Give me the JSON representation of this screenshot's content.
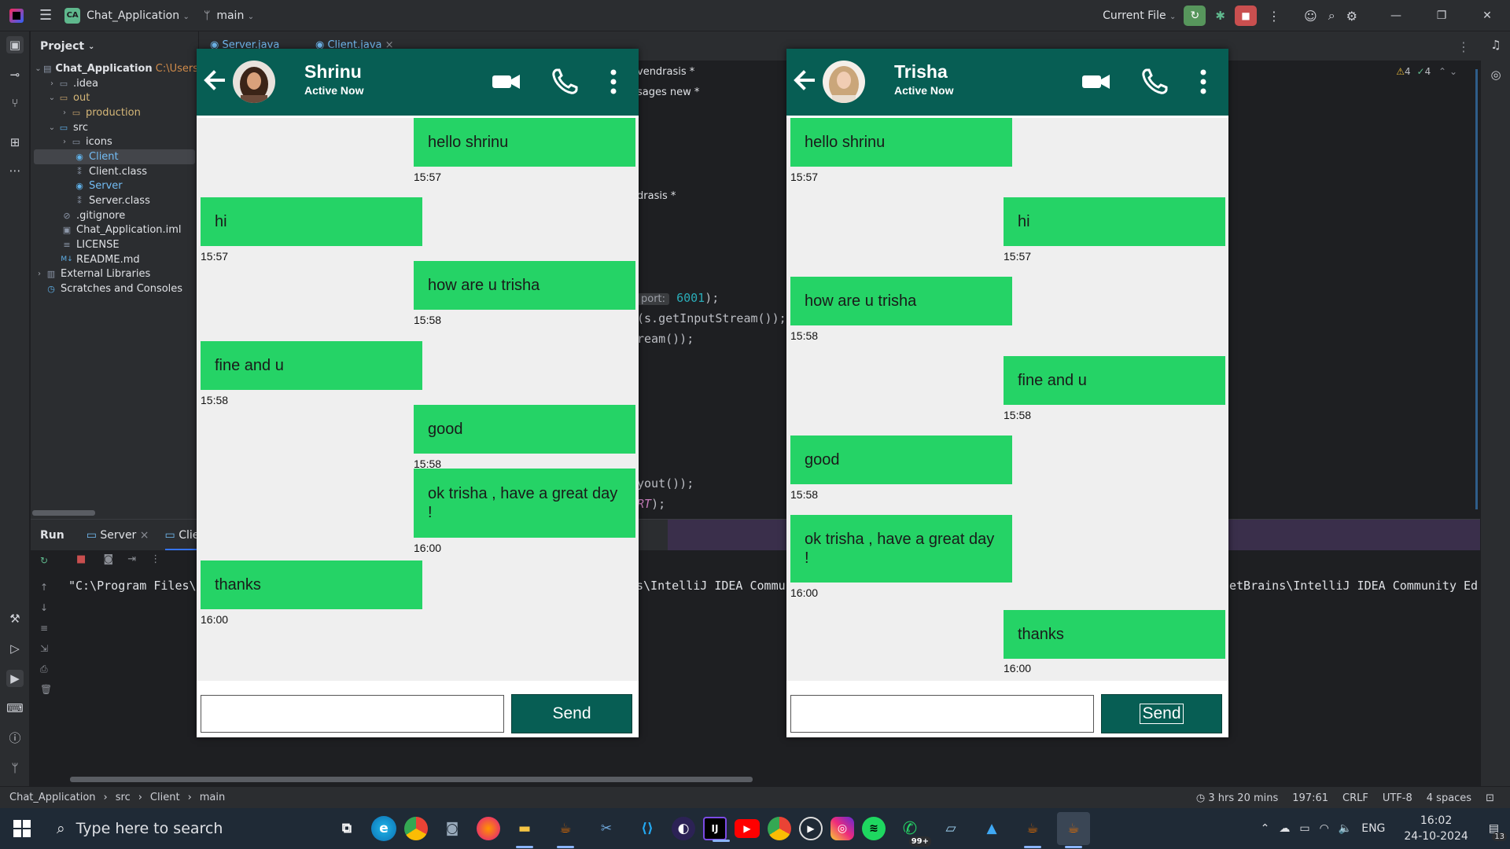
{
  "ide": {
    "project_badge": "CA",
    "project_name": "Chat_Application",
    "branch": "main",
    "run_config": "Current File",
    "project_panel_title": "Project",
    "tree": [
      {
        "label": "Chat_Application",
        "suffix": "C:\\Users",
        "bold": true
      },
      {
        "label": ".idea"
      },
      {
        "label": "out"
      },
      {
        "label": "production"
      },
      {
        "label": "src"
      },
      {
        "label": "icons"
      },
      {
        "label": "Client"
      },
      {
        "label": "Client.class"
      },
      {
        "label": "Server"
      },
      {
        "label": "Server.class"
      },
      {
        "label": ".gitignore"
      },
      {
        "label": "Chat_Application.iml"
      },
      {
        "label": "LICENSE"
      },
      {
        "label": "README.md"
      },
      {
        "label": "External Libraries"
      },
      {
        "label": "Scratches and Consoles"
      }
    ],
    "editor_tabs": [
      "Server.java",
      "Client.java"
    ],
    "warnings": "4",
    "checks": "4",
    "code_fragments": {
      "f1": "vendrasis *",
      "f2": "sages  new *",
      "f3": "drasis *",
      "port_hint": "port:",
      "port_value": "6001",
      "f4_end": ");",
      "f5": "(s.getInputStream());",
      "f6": "ream());",
      "f7": "yout());",
      "f8_kw": "RT",
      "f8_end": ");"
    },
    "run_tabs": {
      "run": "Run",
      "server": "Server",
      "client": "Clie"
    },
    "run_output_left": "\"C:\\Program Files\\",
    "run_output_mid": "s\\IntelliJ IDEA Commu",
    "run_output_right": "etBrains\\IntelliJ IDEA Community Ed"
  },
  "statusbar": {
    "path": [
      "Chat_Application",
      "src",
      "Client",
      "main"
    ],
    "time_tracked": "3 hrs 20 mins",
    "position": "197:61",
    "line_sep": "CRLF",
    "encoding": "UTF-8",
    "indent": "4 spaces"
  },
  "taskbar": {
    "search_placeholder": "Type here to search",
    "whatsapp_badge": "99+",
    "language": "ENG",
    "time": "16:02",
    "date": "24-10-2024",
    "notifications": "13"
  },
  "chat_left": {
    "name": "Shrinu",
    "status": "Active Now",
    "send_label": "Send",
    "input_value": "",
    "messages": [
      {
        "text": "hello shrinu",
        "time": "15:57",
        "sent": true
      },
      {
        "text": "hi",
        "time": "15:57",
        "sent": false
      },
      {
        "text": "how are u trisha",
        "time": "15:58",
        "sent": true
      },
      {
        "text": "fine and u",
        "time": "15:58",
        "sent": false
      },
      {
        "text": "good",
        "time": "15:58",
        "sent": true
      },
      {
        "text": "ok trisha , have a great day !",
        "time": "16:00",
        "sent": true
      },
      {
        "text": "thanks",
        "time": "16:00",
        "sent": false
      }
    ]
  },
  "chat_right": {
    "name": "Trisha",
    "status": "Active Now",
    "send_label": "Send",
    "input_value": "",
    "messages": [
      {
        "text": "hello shrinu",
        "time": "15:57",
        "sent": false
      },
      {
        "text": "hi",
        "time": "15:57",
        "sent": true
      },
      {
        "text": "how are u trisha",
        "time": "15:58",
        "sent": false
      },
      {
        "text": "fine and u",
        "time": "15:58",
        "sent": true
      },
      {
        "text": "good",
        "time": "15:58",
        "sent": false
      },
      {
        "text": "ok trisha , have a great day !",
        "time": "16:00",
        "sent": false
      },
      {
        "text": "thanks",
        "time": "16:00",
        "sent": true
      }
    ]
  },
  "colors": {
    "header_green": "#075e54",
    "bubble_green": "#25d366",
    "chat_bg": "#efefef"
  }
}
